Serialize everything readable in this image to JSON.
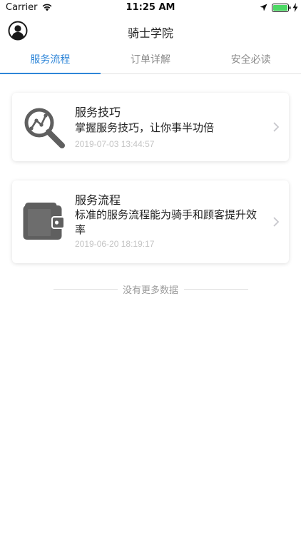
{
  "status_bar": {
    "carrier": "Carrier",
    "time": "11:25 AM"
  },
  "header": {
    "title": "骑士学院"
  },
  "tabs": [
    {
      "label": "服务流程",
      "active": true
    },
    {
      "label": "订单详解",
      "active": false
    },
    {
      "label": "安全必读",
      "active": false
    }
  ],
  "cards": [
    {
      "title": "服务技巧",
      "description": "掌握服务技巧，让你事半功倍",
      "date": "2019-07-03 13:44:57",
      "icon": "magnifier-chart-icon"
    },
    {
      "title": "服务流程",
      "description": "标准的服务流程能为骑手和顾客提升效率",
      "date": "2019-06-20 18:19:17",
      "icon": "wallet-icon"
    }
  ],
  "footer": {
    "no_more_text": "没有更多数据"
  },
  "colors": {
    "accent": "#2f86d8",
    "icon_gray": "#5f5f5f",
    "battery": "#4cd964"
  }
}
